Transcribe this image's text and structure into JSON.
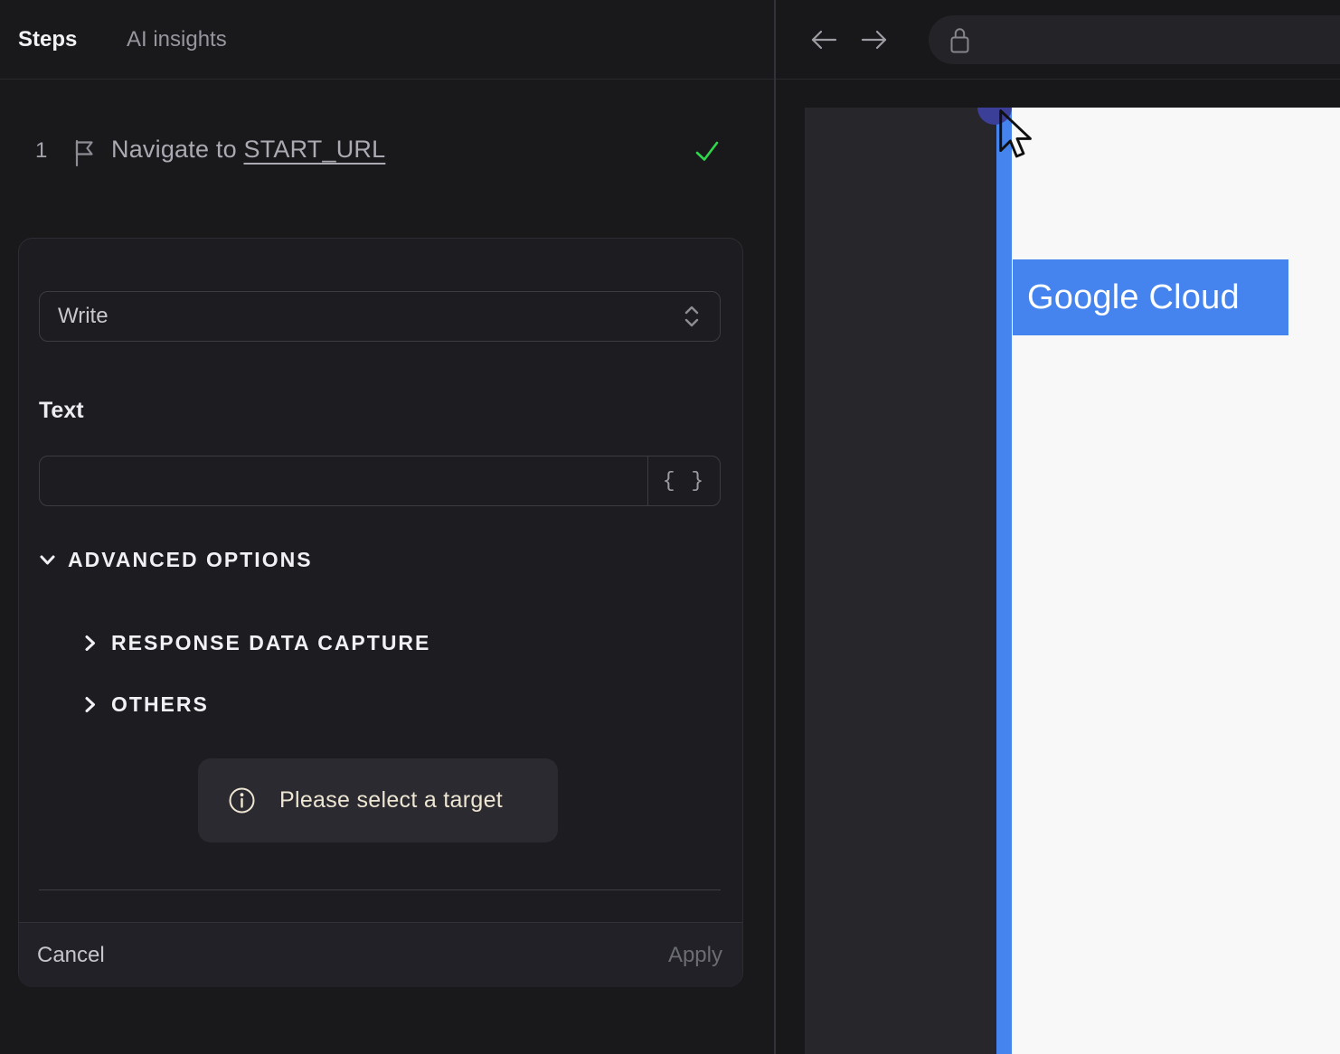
{
  "colors": {
    "accent_blue": "#4584ee",
    "success_green": "#2fd84b",
    "hint_cream": "#eee6d3",
    "indigo_marker": "#3b3f97",
    "page_white": "#f8f8f9",
    "panel_dark": "#19191c"
  },
  "left_panel": {
    "tabs": [
      {
        "label": "Steps",
        "active": true
      },
      {
        "label": "AI insights",
        "active": false
      }
    ],
    "step": {
      "number": "1",
      "action": "Navigate to ",
      "target": "START_URL",
      "status": "success"
    },
    "editor": {
      "action_select": {
        "value": "Write"
      },
      "text_field": {
        "label": "Text",
        "value": "",
        "braces_label": "{ }"
      },
      "sections": {
        "advanced": "ADVANCED OPTIONS",
        "response_capture": "RESPONSE DATA CAPTURE",
        "others": "OTHERS"
      },
      "hint": "Please select a target",
      "cancel_label": "Cancel",
      "apply_label": "Apply"
    }
  },
  "browser": {
    "url_bar": {
      "value": ""
    },
    "page": {
      "highlight_label": "Google Cloud"
    }
  }
}
